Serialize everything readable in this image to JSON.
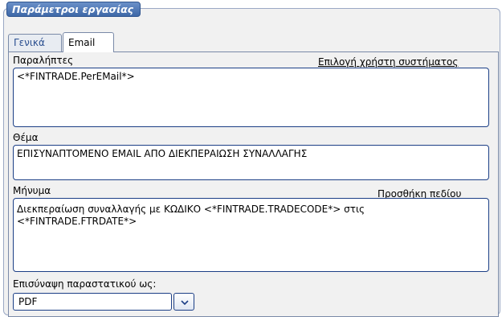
{
  "group": {
    "title": "Παράμετροι εργασίας"
  },
  "tabs": [
    {
      "label": "Γενικά",
      "active": false
    },
    {
      "label": "Email",
      "active": true
    }
  ],
  "recipients": {
    "label": "Παραλήπτες",
    "link": "Επιλογή χρήστη συστήματος",
    "value": "<*FINTRADE.PerEMail*>"
  },
  "subject": {
    "label": "Θέμα",
    "value": "ΕΠΙΣΥΝΑΠΤΟΜΕΝΟ EMAIL ΑΠΟ ΔΙΕΚΠΕΡΑΙΩΣΗ ΣΥΝΑΛΛΑΓΗΣ"
  },
  "message": {
    "label": "Μήνυμα",
    "link": "Προσθήκη πεδίου",
    "line1": "Διεκπεραίωση συναλλαγής με ΚΩΔΙΚΟ <*FINTRADE.TRADECODE*> στις",
    "line2": "<*FINTRADE.FTRDATE*>"
  },
  "attach": {
    "label": "Επισύναψη παραστατικού ως:",
    "value": "PDF"
  },
  "colors": {
    "accent": "#3e68a8",
    "field_border": "#1c3f86",
    "panel_bg": "#f1f1f1"
  },
  "icons": {
    "dropdown": "chevron-down-icon"
  }
}
